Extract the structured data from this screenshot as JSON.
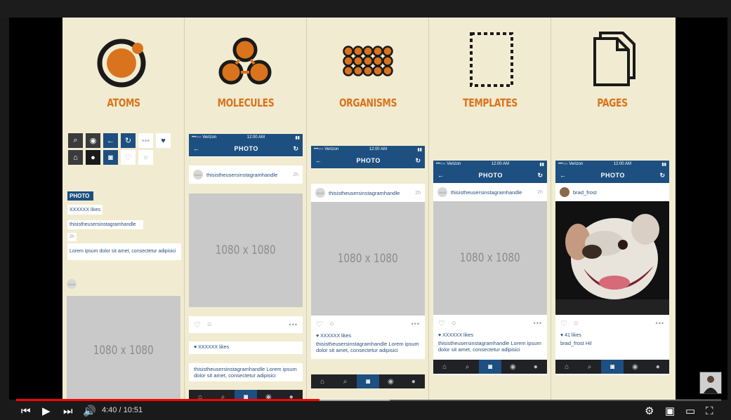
{
  "columns": [
    {
      "title": "ATOMS"
    },
    {
      "title": "MOLECULES"
    },
    {
      "title": "ORGANISMS"
    },
    {
      "title": "TEMPLATES"
    },
    {
      "title": "PAGES"
    }
  ],
  "atoms": {
    "photo_label": "PHOTO",
    "likes": "XXXXXX likes",
    "handle": "thisistheusersinstagramhandle",
    "time": "2h",
    "lorem": "Lorem ipsum dolor sit amet, consectetur adipisici",
    "avatar_text": "36x36",
    "image_size": "1080 x 1080"
  },
  "phone": {
    "carrier": "•••○○ Verizon",
    "clock": "12:00 AM",
    "nav_title": "PHOTO",
    "handle": "thisistheusersinstagramhandle",
    "time": "2h",
    "avatar_text": "36x36",
    "image_size": "1080 x 1080",
    "likes": "♥ XXXXXX likes",
    "caption": "thisistheusersinstagramhandle Lorem ipsum dolor sit amet, consectetur adipisici",
    "more": "•••"
  },
  "page": {
    "handle": "brad_frost",
    "likes": "♥ 41 likes",
    "caption": "brad_frost Hi!"
  },
  "player": {
    "current_time": "4:40",
    "separator": "/",
    "duration": "10:51",
    "progress_fraction": 0.43,
    "buffered_fraction": 0.53,
    "accent": "#ff0000"
  }
}
